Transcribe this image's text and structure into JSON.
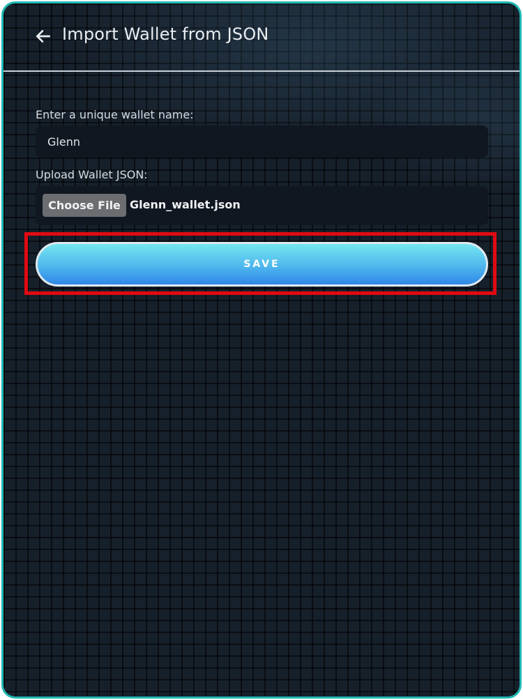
{
  "header": {
    "title": "Import Wallet from JSON",
    "back_icon": "arrow-left-icon"
  },
  "form": {
    "wallet_name_label": "Enter a unique wallet name:",
    "wallet_name_value": "Glenn",
    "upload_label": "Upload Wallet JSON:",
    "choose_file_label": "Choose File",
    "selected_file_name": "Glenn_wallet.json",
    "save_label": "SAVE"
  },
  "colors": {
    "frame_border": "#20b8b3",
    "background": "#16202b",
    "field_background": "#101720",
    "save_gradient_top": "#74e6ef",
    "save_gradient_bottom": "#2f87e6",
    "highlight": "#e00a12"
  }
}
